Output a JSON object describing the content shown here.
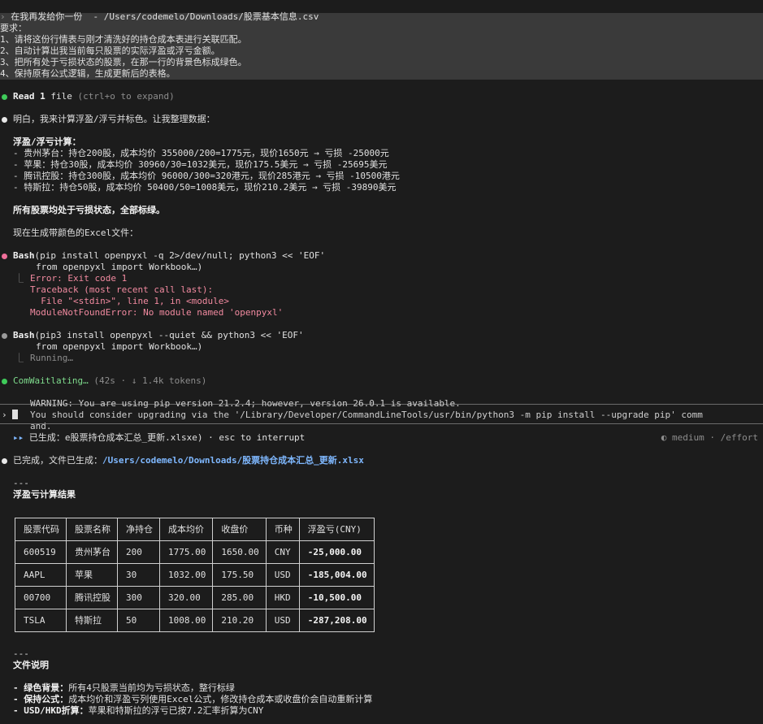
{
  "prompt": {
    "line1": "在我再发给你一份  - /Users/codemelo/Downloads/股票基本信息.csv",
    "line2": "要求：",
    "line3": "1、请将这份行情表与刚才清洗好的持仓成本表进行关联匹配。",
    "line4": "2、自动计算出我当前每只股票的实际浮盈或浮亏金额。",
    "line5": "3、把所有处于亏损状态的股票，在那一行的背景色标成绿色。",
    "line6": "4、保持原有公式逻辑，生成更新后的表格。",
    "prefix": "›"
  },
  "read": {
    "label": "Read",
    "count": "1",
    "word": "file",
    "hint": "(ctrl+o to expand)"
  },
  "msg1": {
    "intro": "明白，我来计算浮盈/浮亏并标色。让我整理数据：",
    "calc_title": "浮盈/浮亏计算：",
    "calc_lines": [
      "- 贵州茅台：持仓200股，成本均价 355000/200=1775元，现价1650元 → 亏损 -25000元",
      "- 苹果：持仓30股，成本均价 30960/30=1032美元，现价175.5美元 → 亏损 -25695美元",
      "- 腾讯控股：持仓300股，成本均价 96000/300=320港元，现价285港元 → 亏损 -10500港元",
      "- 特斯拉：持仓50股，成本均价 50400/50=1008美元，现价210.2美元 → 亏损 -39890美元"
    ],
    "all_loss": "所有股票均处于亏损状态，全部标绿。",
    "generating": "现在生成带颜色的Excel文件："
  },
  "bash1": {
    "label": "Bash",
    "cmd": "(pip install openpyxl -q 2>/dev/null; python3 << 'EOF'",
    "cmd2": "from openpyxl import Workbook…)",
    "err_lines": [
      "Error: Exit code 1",
      "Traceback (most recent call last):",
      "  File \"<stdin>\", line 1, in <module>",
      "ModuleNotFoundError: No module named 'openpyxl'"
    ],
    "branch": "⎿"
  },
  "bash2": {
    "label": "Bash",
    "cmd": "(pip3 install openpyxl --quiet && python3 << 'EOF'",
    "cmd2": "from openpyxl import Workbook…)",
    "status": "Running…",
    "branch": "⎿"
  },
  "spinner": {
    "word": "ComWaitlating…",
    "stats": "(42s · ↓ 1.4k tokens)"
  },
  "warning": {
    "line1": "WARNING: You are using pip version 21.2.4; however, version 26.0.1 is available.",
    "line2": "You should consider upgrading via the '/Library/Developer/CommandLineTools/usr/bin/python3 -m pip install --upgrade pip' comm",
    "line3": "and.",
    "prompt_char": "›"
  },
  "footer": {
    "mode_icon": "▸▸",
    "left": "已生成：e股票持仓成本汇总_更新.xlsxe) · esc to interrupt",
    "right": "◐ medium · /effort"
  },
  "done": {
    "prefix": "已完成，文件已生成：",
    "path": "/Users/codemelo/Downloads/股票持仓成本汇总_更新.xlsx",
    "sep": "---",
    "section": "浮盈亏计算结果"
  },
  "table": {
    "headers": [
      "股票代码",
      "股票名称",
      "净持仓",
      "成本均价",
      "收盘价",
      "币种",
      "浮盈亏(CNY)"
    ],
    "rows": [
      [
        "600519",
        "贵州茅台",
        "200",
        "1775.00",
        "1650.00",
        "CNY",
        "-25,000.00"
      ],
      [
        "AAPL",
        "苹果",
        "30",
        "1032.00",
        "175.50",
        "USD",
        "-185,004.00"
      ],
      [
        "00700",
        "腾讯控股",
        "300",
        "320.00",
        "285.00",
        "HKD",
        "-10,500.00"
      ],
      [
        "TSLA",
        "特斯拉",
        "50",
        "1008.00",
        "210.20",
        "USD",
        "-287,208.00"
      ]
    ]
  },
  "notes": {
    "sep": "---",
    "title": "文件说明",
    "items": [
      {
        "key": "- 绿色背景：",
        "text": "所有4只股票当前均为亏损状态，整行标绿"
      },
      {
        "key": "- 保持公式：",
        "text": "成本均价和浮盈亏列使用Excel公式，修改持仓成本或收盘价会自动重新计算"
      },
      {
        "key": "- USD/HKD折算：",
        "text": "苹果和特斯拉的浮亏已按7.2汇率折算为CNY"
      }
    ]
  },
  "colors": {
    "bg": "#1c1c1c",
    "prompt_bg": "#3a3a3a",
    "success": "#3fcb5a",
    "error": "#f06f9a",
    "path": "#7fb8ff"
  }
}
